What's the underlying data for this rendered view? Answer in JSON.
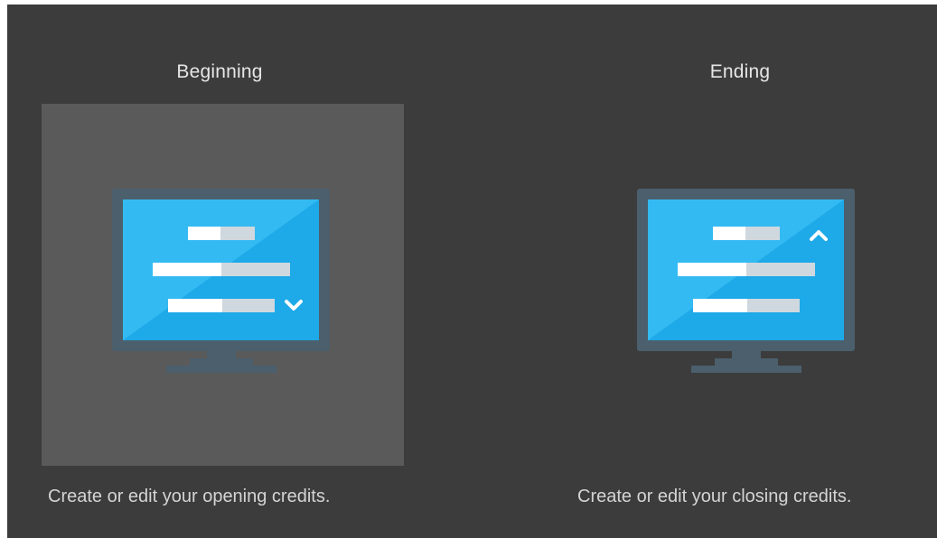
{
  "options": [
    {
      "id": "beginning",
      "title": "Beginning",
      "description": "Create or edit your opening credits.",
      "selected": true,
      "icon": "monitor-credits-scroll-down-icon"
    },
    {
      "id": "ending",
      "title": "Ending",
      "description": "Create or edit your closing credits.",
      "selected": false,
      "icon": "monitor-credits-scroll-up-icon"
    }
  ],
  "colors": {
    "background": "#3c3c3d",
    "selected_tile": "#5a5a5b",
    "monitor_frame": "#4b5f6c",
    "screen_blue": "#1ea9e8",
    "screen_highlight": "#38bdf3",
    "bar_white": "#ffffff",
    "bar_grey": "#cfd8de",
    "title_text": "#e6e6e6",
    "desc_text": "#d4d4d4"
  }
}
